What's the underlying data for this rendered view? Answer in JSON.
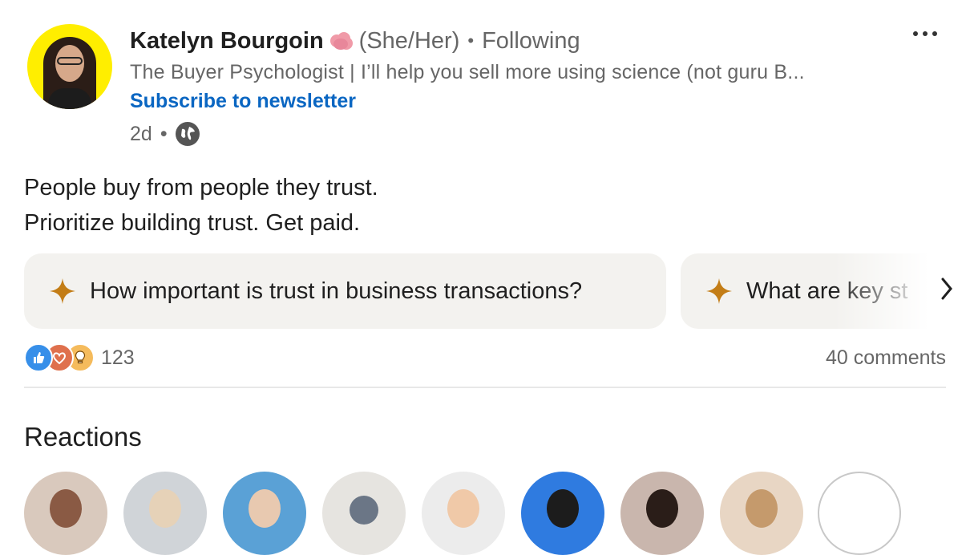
{
  "post": {
    "author": {
      "name": "Katelyn Bourgoin",
      "pronouns": "(She/Her)",
      "separator": "•",
      "follow_status": "Following",
      "emoji_icon": "brain-emoji-icon",
      "headline": "The Buyer Psychologist | I’ll help you sell more using science (not guru B...",
      "newsletter_link": "Subscribe to newsletter"
    },
    "meta": {
      "age": "2d",
      "separator": "•",
      "visibility_icon": "globe-icon"
    },
    "text": {
      "line1": "People buy from people they trust.",
      "line2": "Prioritize building trust. Get paid."
    },
    "ai_prompts": [
      {
        "icon": "sparkle-icon",
        "label": "How important is trust in business transactions?"
      },
      {
        "icon": "sparkle-icon",
        "label": "What are key st"
      }
    ],
    "social": {
      "reaction_icons": [
        "like-icon",
        "love-icon",
        "insightful-icon"
      ],
      "reaction_count": "123",
      "comments": "40 comments"
    }
  },
  "reactions_section": {
    "title": "Reactions"
  },
  "colors": {
    "link": "#0a66c2",
    "muted": "#666666",
    "chip_bg": "#f3f2ef",
    "sparkle": "#c37d16"
  }
}
